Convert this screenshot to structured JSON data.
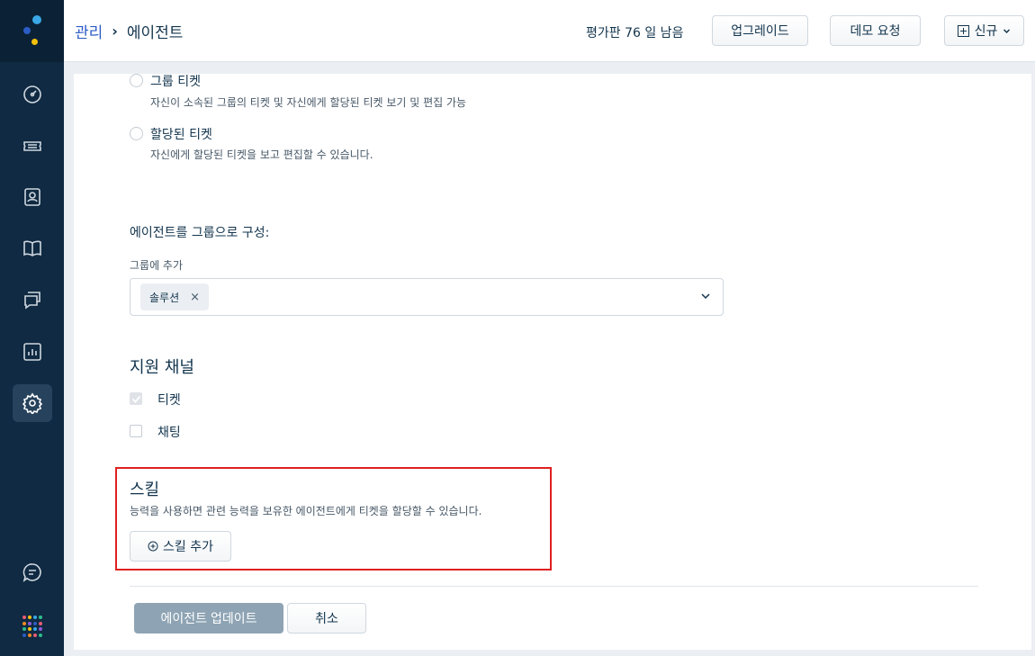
{
  "header": {
    "breadcrumb_parent": "관리",
    "breadcrumb_separator": "›",
    "breadcrumb_current": "에이전트",
    "trial_text": "평가판 76 일 남음",
    "upgrade_label": "업그레이드",
    "demo_label": "데모 요청",
    "new_label": "신규"
  },
  "sidebar": {
    "items": [
      {
        "icon": "dashboard-icon"
      },
      {
        "icon": "tickets-icon"
      },
      {
        "icon": "contacts-icon"
      },
      {
        "icon": "solutions-icon"
      },
      {
        "icon": "forums-icon"
      },
      {
        "icon": "reports-icon"
      },
      {
        "icon": "admin-gear-icon",
        "active": true
      }
    ],
    "bottom": [
      {
        "icon": "chat-icon"
      },
      {
        "icon": "apps-grid-icon"
      }
    ],
    "grid_colors": [
      "#e85d75",
      "#f6c10c",
      "#3aa8e6",
      "#2dbd8c",
      "#f08a24",
      "#8e5bd9",
      "#2c5cc5",
      "#e85d75",
      "#2dbd8c",
      "#f6c10c",
      "#3aa8e6",
      "#8e5bd9",
      "#2c5cc5",
      "#f08a24",
      "#e85d75",
      "#2dbd8c"
    ]
  },
  "scope": {
    "group_ticket_label": "그룹 티켓",
    "group_ticket_help": "자신이 소속된 그룹의 티켓 및 자신에게 할당된 티켓 보기 및 편집 가능",
    "assigned_ticket_label": "할당된 티켓",
    "assigned_ticket_help": "자신에게 할당된 티켓을 보고 편집할 수 있습니다."
  },
  "groups": {
    "heading": "에이전트를 그룹으로 구성:",
    "add_label": "그룹에 추가",
    "chips": [
      "솔루션"
    ],
    "chip_remove": "×"
  },
  "channels": {
    "heading": "지원 채널",
    "items": [
      {
        "label": "티켓",
        "checked": true
      },
      {
        "label": "채팅",
        "checked": false
      }
    ]
  },
  "skills": {
    "heading": "스킬",
    "description": "능력을 사용하면 관련 능력을 보유한 에이전트에게 티켓을 할당할 수 있습니다.",
    "add_label": "스킬 추가"
  },
  "footer": {
    "update_label": "에이전트 업데이트",
    "cancel_label": "취소"
  },
  "colors": {
    "sidebar_bg": "#0f2a42",
    "highlight": "#e02020",
    "primary_disabled": "#8ea4b4"
  }
}
